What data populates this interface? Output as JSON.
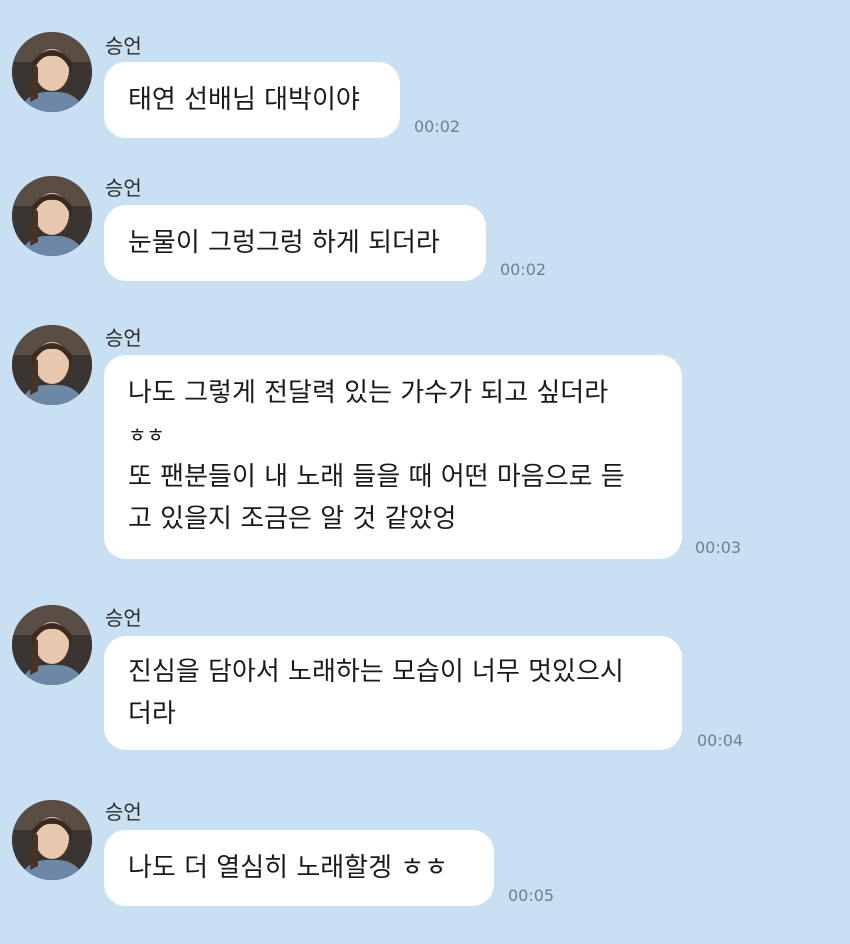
{
  "messages": [
    {
      "sender": "승언",
      "lines": [
        "태연 선배님 대박이야"
      ],
      "time": "00:02"
    },
    {
      "sender": "승언",
      "lines": [
        "눈물이 그렁그렁 하게 되더라"
      ],
      "time": "00:02"
    },
    {
      "sender": "승언",
      "lines": [
        "나도 그렇게 전달력 있는 가수가 되고 싶더라",
        "ㅎㅎ",
        "또 팬분들이 내 노래 들을 때 어떤 마음으로 듣",
        "고 있을지 조금은 알 것 같았엉"
      ],
      "time": "00:03"
    },
    {
      "sender": "승언",
      "lines": [
        "진심을 담아서 노래하는 모습이 너무 멋있으시",
        "더라"
      ],
      "time": "00:04"
    },
    {
      "sender": "승언",
      "lines": [
        "나도 더 열심히 노래할겡 ㅎㅎ"
      ],
      "time": "00:05"
    }
  ],
  "colors": {
    "background": "#c9dff2",
    "bubble": "#ffffff",
    "timestamp": "#6f7f8e"
  },
  "icons": {
    "avatar": "profile-photo-avatar-icon"
  }
}
